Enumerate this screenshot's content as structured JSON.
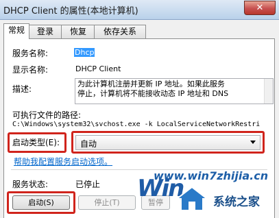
{
  "window": {
    "title": "DHCP Client 的属性(本地计算机)",
    "close_label": "✕"
  },
  "tabs": [
    {
      "label": "常规",
      "active": true
    },
    {
      "label": "登录",
      "active": false
    },
    {
      "label": "恢复",
      "active": false
    },
    {
      "label": "依存关系",
      "active": false
    }
  ],
  "general": {
    "service_name_label": "服务名称:",
    "service_name": "Dhcp",
    "display_name_label": "显示名称:",
    "display_name": "DHCP Client",
    "description_label": "描述:",
    "description_lines": [
      "为此计算机注册并更新 IP 地址。如果此服务",
      "停止，计算机将不能接收动态 IP 地址和 DNS"
    ],
    "exe_path_label": "可执行文件的路径:",
    "exe_path": "C:\\Windows\\system32\\svchost.exe -k LocalServiceNetworkRestri",
    "startup_type_label": "启动类型(E):",
    "startup_type": "自动",
    "help_link": "帮助我配置服务启动选项。",
    "status_label": "服务状态:",
    "status_value": "已停止"
  },
  "buttons": {
    "start": "启动(S)",
    "stop": "停止(T)",
    "pause": "暂停"
  },
  "watermark": {
    "url": "www.win7zhijia.cn",
    "logo_text": "系统之家",
    "win_text": "Win"
  },
  "colors": {
    "highlight": "#d0241c",
    "link": "#0066cc"
  }
}
